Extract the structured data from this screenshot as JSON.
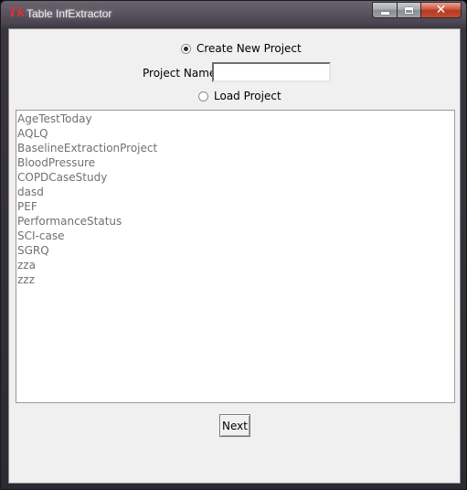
{
  "window": {
    "title": "Table InfExtractor",
    "icon": "tk-feather-icon",
    "caption_buttons": [
      "minimize",
      "maximize",
      "close"
    ],
    "close_glyph": "✕"
  },
  "form": {
    "create_option": {
      "label": "Create New Project",
      "checked": true
    },
    "project_name": {
      "label": "Project Name",
      "value": ""
    },
    "load_option": {
      "label": "Load Project",
      "checked": false
    }
  },
  "projects": [
    "AgeTestToday",
    "AQLQ",
    "BaselineExtractionProject",
    "BloodPressure",
    "COPDCaseStudy",
    "dasd",
    "PEF",
    "PerformanceStatus",
    "SCI-case",
    "SGRQ",
    "zza",
    "zzz"
  ],
  "buttons": {
    "next_label": "Next"
  },
  "colors": {
    "client_background": "#f0f0f0",
    "list_text": "#707070",
    "close_button": "#c84a32"
  }
}
